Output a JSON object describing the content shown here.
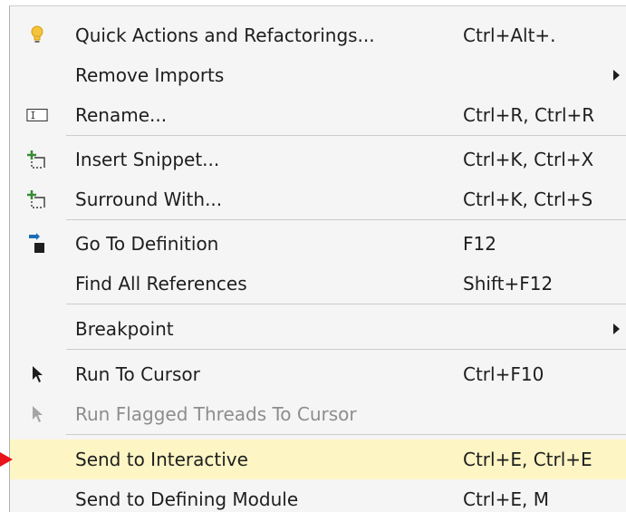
{
  "menu": {
    "items": [
      {
        "label": "Quick Actions and Refactorings...",
        "shortcut": "Ctrl+Alt+.",
        "icon": "lightbulb-icon"
      },
      {
        "label": "Remove Imports",
        "shortcut": "",
        "icon": "",
        "submenu": true
      },
      {
        "label": "Rename...",
        "shortcut": "Ctrl+R, Ctrl+R",
        "icon": "rename-icon"
      },
      {
        "label": "Insert Snippet...",
        "shortcut": "Ctrl+K, Ctrl+X",
        "icon": "insert-snippet-icon"
      },
      {
        "label": "Surround With...",
        "shortcut": "Ctrl+K, Ctrl+S",
        "icon": "surround-with-icon"
      },
      {
        "label": "Go To Definition",
        "shortcut": "F12",
        "icon": "go-to-definition-icon"
      },
      {
        "label": "Find All References",
        "shortcut": "Shift+F12",
        "icon": ""
      },
      {
        "label": "Breakpoint",
        "shortcut": "",
        "icon": "",
        "submenu": true
      },
      {
        "label": "Run To Cursor",
        "shortcut": "Ctrl+F10",
        "icon": "cursor-arrow-icon"
      },
      {
        "label": "Run Flagged Threads To Cursor",
        "shortcut": "",
        "icon": "cursor-arrow-disabled-icon",
        "disabled": true
      },
      {
        "label": "Send to Interactive",
        "shortcut": "Ctrl+E, Ctrl+E",
        "icon": "",
        "highlighted": true
      },
      {
        "label": "Send to Defining Module",
        "shortcut": "Ctrl+E, M",
        "icon": ""
      }
    ]
  },
  "colors": {
    "menu_background": "#f5f5f5",
    "highlight": "#fdf5c4",
    "disabled_text": "#8d8d8d",
    "pointer_arrow": "#e8141b"
  }
}
